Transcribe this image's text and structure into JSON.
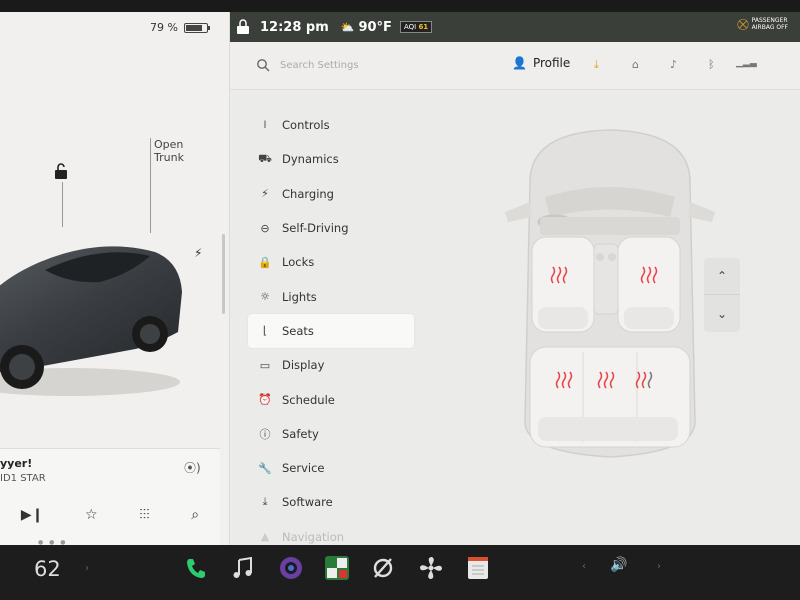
{
  "car": {
    "battery_percent": "79 %",
    "open_trunk_label": "Open\nTrunk"
  },
  "media": {
    "title": "yyer!",
    "subtitle": "ID1 STAR"
  },
  "status": {
    "time": "12:28 pm",
    "weather": "90°F",
    "aqi_label": "AQI",
    "aqi_value": "61",
    "airbag_line1": "PASSENGER",
    "airbag_line2": "AIRBAG OFF"
  },
  "header": {
    "search_placeholder": "Search Settings",
    "profile_label": "Profile"
  },
  "menu": {
    "items": [
      {
        "label": "Controls",
        "icon": "toggle-icon"
      },
      {
        "label": "Dynamics",
        "icon": "car-icon"
      },
      {
        "label": "Charging",
        "icon": "bolt-icon"
      },
      {
        "label": "Self-Driving",
        "icon": "steering-wheel-icon"
      },
      {
        "label": "Locks",
        "icon": "lock-icon"
      },
      {
        "label": "Lights",
        "icon": "sun-icon"
      },
      {
        "label": "Seats",
        "icon": "seat-icon"
      },
      {
        "label": "Display",
        "icon": "display-icon"
      },
      {
        "label": "Schedule",
        "icon": "alarm-clock-icon"
      },
      {
        "label": "Safety",
        "icon": "alert-circle-icon"
      },
      {
        "label": "Service",
        "icon": "wrench-icon"
      },
      {
        "label": "Software",
        "icon": "download-icon"
      },
      {
        "label": "Navigation",
        "icon": "navigation-icon"
      }
    ],
    "selected": "Seats"
  },
  "dock": {
    "temperature": "62"
  },
  "colors": {
    "seat_heat_on": "#e8454c",
    "seat_heat_off": "#7a7a7a",
    "phone_green": "#2ecc71",
    "download_orange": "#e8a020"
  }
}
